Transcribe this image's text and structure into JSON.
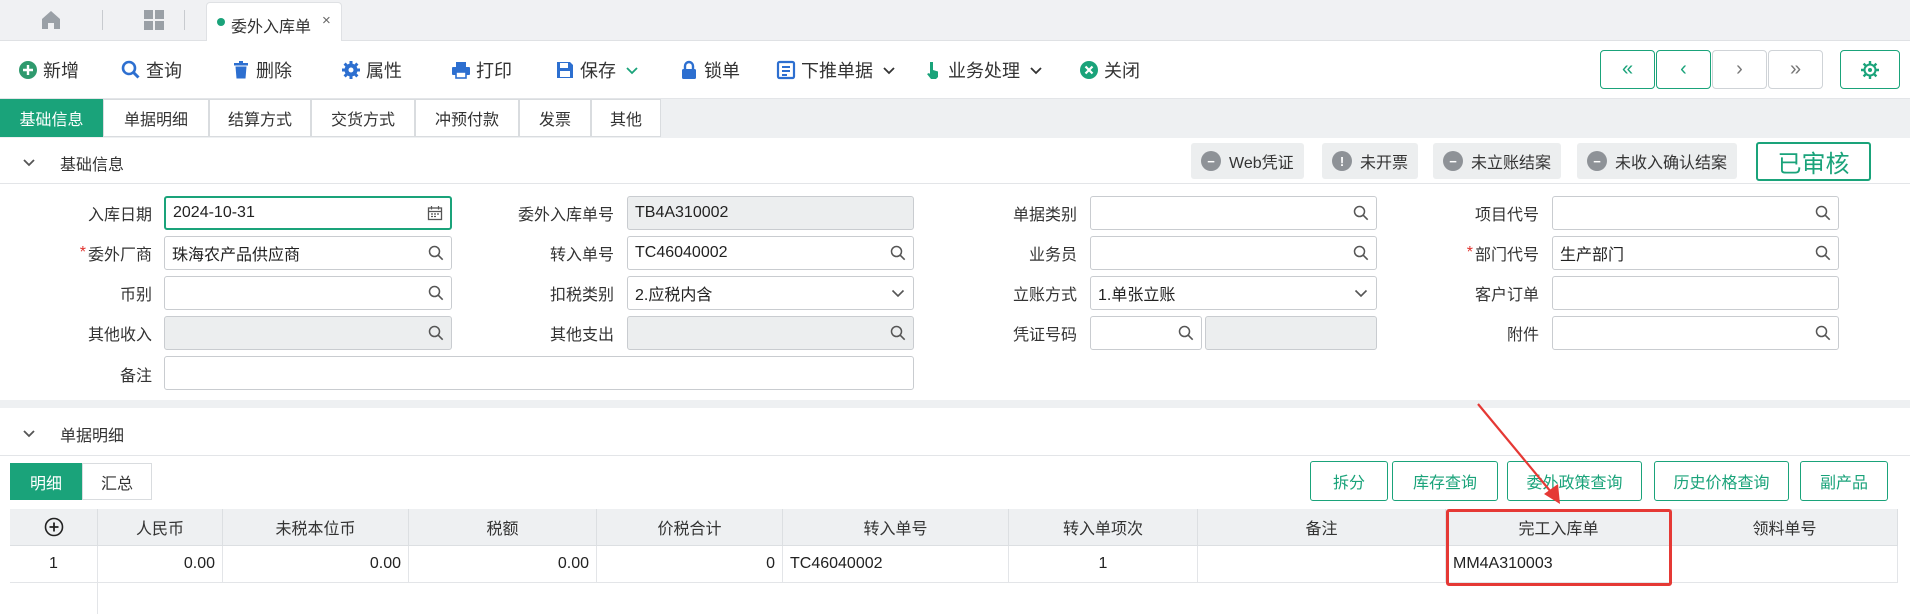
{
  "tabstrip": {
    "home_icon": "home-icon",
    "apps_icon": "grid-icon",
    "doc_tab": {
      "label": "委外入库单",
      "close": "×"
    }
  },
  "toolbar": {
    "add": "新增",
    "query": "查询",
    "delete": "删除",
    "properties": "属性",
    "print": "打印",
    "save": "保存",
    "lock": "锁单",
    "push_down": "下推单据",
    "business": "业务处理",
    "close": "关闭",
    "nav": [
      "«",
      "‹",
      "›",
      "»"
    ],
    "settings_icon": "gear-icon"
  },
  "section_tabs": [
    "基础信息",
    "单据明细",
    "结算方式",
    "交货方式",
    "冲预付款",
    "发票",
    "其他"
  ],
  "basic": {
    "title": "基础信息",
    "badges": [
      "Web凭证",
      "未开票",
      "未立账结案",
      "未收入确认结案"
    ],
    "status": "已审核",
    "fields": {
      "in_date": {
        "label": "入库日期",
        "value": "2024-10-31"
      },
      "vendor": {
        "label": "委外厂商",
        "value": "珠海农产品供应商"
      },
      "currency": {
        "label": "币别",
        "value": ""
      },
      "other_income": {
        "label": "其他收入",
        "value": ""
      },
      "remark": {
        "label": "备注",
        "value": ""
      },
      "doc_no": {
        "label": "委外入库单号",
        "value": "TB4A310002"
      },
      "transfer_no": {
        "label": "转入单号",
        "value": "TC46040002"
      },
      "tax_type": {
        "label": "扣税类别",
        "value": "2.应税内含"
      },
      "other_expense": {
        "label": "其他支出",
        "value": ""
      },
      "doc_type": {
        "label": "单据类别",
        "value": ""
      },
      "salesman": {
        "label": "业务员",
        "value": ""
      },
      "account_method": {
        "label": "立账方式",
        "value": "1.单张立账"
      },
      "voucher_no": {
        "label": "凭证号码",
        "value": ""
      },
      "project_code": {
        "label": "项目代号",
        "value": ""
      },
      "dept_code": {
        "label": "部门代号",
        "value": "生产部门"
      },
      "customer_order": {
        "label": "客户订单",
        "value": ""
      },
      "attachment": {
        "label": "附件",
        "value": ""
      }
    }
  },
  "detail": {
    "title": "单据明细",
    "subtabs": [
      "明细",
      "汇总"
    ],
    "buttons": [
      "拆分",
      "库存查询",
      "委外政策查询",
      "历史价格查询",
      "副产品"
    ],
    "add_row_icon": "plus-circle-icon",
    "columns": [
      "人民币",
      "未税本位币",
      "税额",
      "价税合计",
      "转入单号",
      "转入单项次",
      "备注",
      "完工入库单",
      "领料单号"
    ],
    "rows": [
      {
        "no": "1",
        "rmb": "0.00",
        "untaxed": "0.00",
        "tax": "0.00",
        "total": "0",
        "transfer_no": "TC46040002",
        "transfer_item": "1",
        "remark": "",
        "finished_in": "MM4A310003",
        "pick_no": ""
      }
    ],
    "highlight_color": "#e53935"
  },
  "colors": {
    "accent": "#1aa37a",
    "required": "#e0302b",
    "highlight": "#e53935"
  }
}
